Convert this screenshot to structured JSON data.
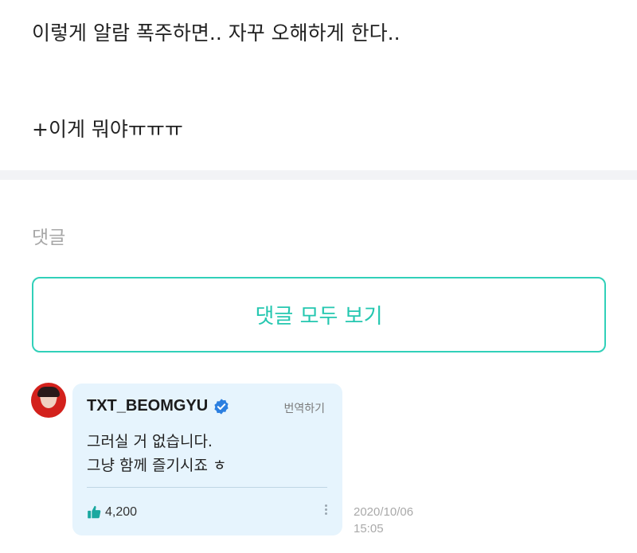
{
  "post": {
    "line1": "이렇게 알람 폭주하면.. 자꾸 오해하게 한다..",
    "line2": "+이게 뭐야ㅠㅠㅠ"
  },
  "comments": {
    "heading": "댓글",
    "view_all_label": "댓글 모두 보기"
  },
  "comment": {
    "author": "TXT_BEOMGYU",
    "translate_label": "번역하기",
    "text_line1": "그러실 거 없습니다.",
    "text_line2": "그냥 함께 즐기시죠 ㅎ",
    "likes": "4,200",
    "date": "2020/10/06",
    "time": "15:05"
  },
  "colors": {
    "accent": "#25c7b0",
    "bubble": "#e6f4fd",
    "verified": "#2b7fe0",
    "like": "#1aa8a0"
  },
  "icons": [
    "verified-badge-icon",
    "thumbs-up-icon",
    "more-vertical-icon"
  ]
}
